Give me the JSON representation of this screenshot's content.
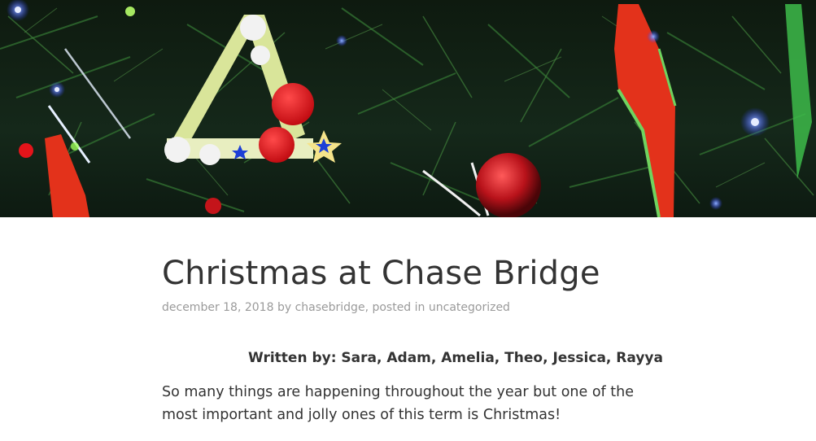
{
  "header_image": {
    "alt": "",
    "colors": {
      "tree_dark": "#0d1a11",
      "needle": "#2f6a2f",
      "stick": "#d9e59a",
      "pompom_red": "#e3141a",
      "pompom_white": "#f2f2f2",
      "felt_red": "#e3321b",
      "light_blue": "#3a5cff",
      "bauble_red": "#b8121a",
      "star_yellow": "#f5e38a",
      "star_blue": "#1d3fd6"
    }
  },
  "post": {
    "title": "Christmas at Chase Bridge",
    "meta": {
      "date": "december 18, 2018",
      "by_text": " by ",
      "author": "chasebridge",
      "posted_in_text": ", posted in ",
      "category": "uncategorized"
    },
    "author_line": "Written by: Sara, Adam, Amelia, Theo, Jessica, Rayya",
    "paragraphs": [
      "So many things are happening throughout the year but one of the most important and jolly ones of this term is Christmas!"
    ]
  }
}
